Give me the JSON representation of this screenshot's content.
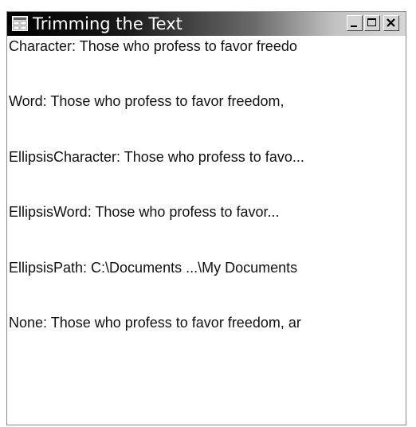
{
  "window": {
    "title": "Trimming the Text",
    "icon": "window-form-icon",
    "controls": {
      "minimize": "minimize-icon",
      "maximize": "maximize-icon",
      "close": "close-icon"
    }
  },
  "lines": [
    "Character: Those who profess to favor freedo",
    "Word: Those who profess to favor freedom,",
    "EllipsisCharacter: Those who profess to favo...",
    "EllipsisWord: Those who profess to favor...",
    "EllipsisPath:  C:\\Documents  ...\\My Documents",
    "None: Those who profess to favor freedom, ar"
  ],
  "colors": {
    "title_text": "#ffffff",
    "client_background": "#ffffff",
    "text": "#111111"
  }
}
